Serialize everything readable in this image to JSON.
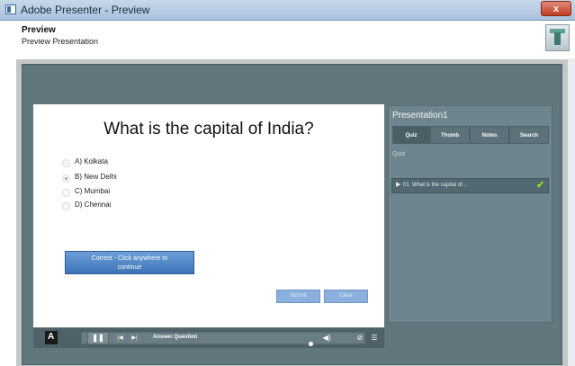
{
  "window": {
    "title": "Adobe Presenter - Preview",
    "close_label": "x"
  },
  "dialog": {
    "heading": "Preview",
    "subheading": "Preview Presentation"
  },
  "slide": {
    "question": "What is the capital of India?",
    "options": [
      {
        "label": "A)  Kolkata",
        "selected": false
      },
      {
        "label": "B)  New Delhi",
        "selected": true
      },
      {
        "label": "C)  Mumbai",
        "selected": false
      },
      {
        "label": "D)  Chennai",
        "selected": false
      }
    ],
    "feedback_line1": "Correct - Click anywhere to",
    "feedback_line2": "continue",
    "submit_label": "Submit",
    "clear_label": "Clear"
  },
  "panel": {
    "title": "Presentation1",
    "tabs": [
      "Quiz",
      "Thumb",
      "Notes",
      "Search"
    ],
    "active_tab": "Quiz",
    "section_label": "Quiz",
    "items": [
      {
        "label": "01. What is the capital of...",
        "status": "correct"
      }
    ]
  },
  "controls": {
    "slide_name": "Answer Question",
    "play_glyph": "❚❚",
    "prev_glyph": "|◀",
    "next_glyph": "▶|",
    "volume_glyph": "◀)",
    "pin_glyph": "⊘",
    "list_glyph": "☰"
  },
  "colors": {
    "accent": "#4a80c4",
    "panel_bg": "#6e858d",
    "stage_bg": "#62767d",
    "check": "#88e02a"
  }
}
